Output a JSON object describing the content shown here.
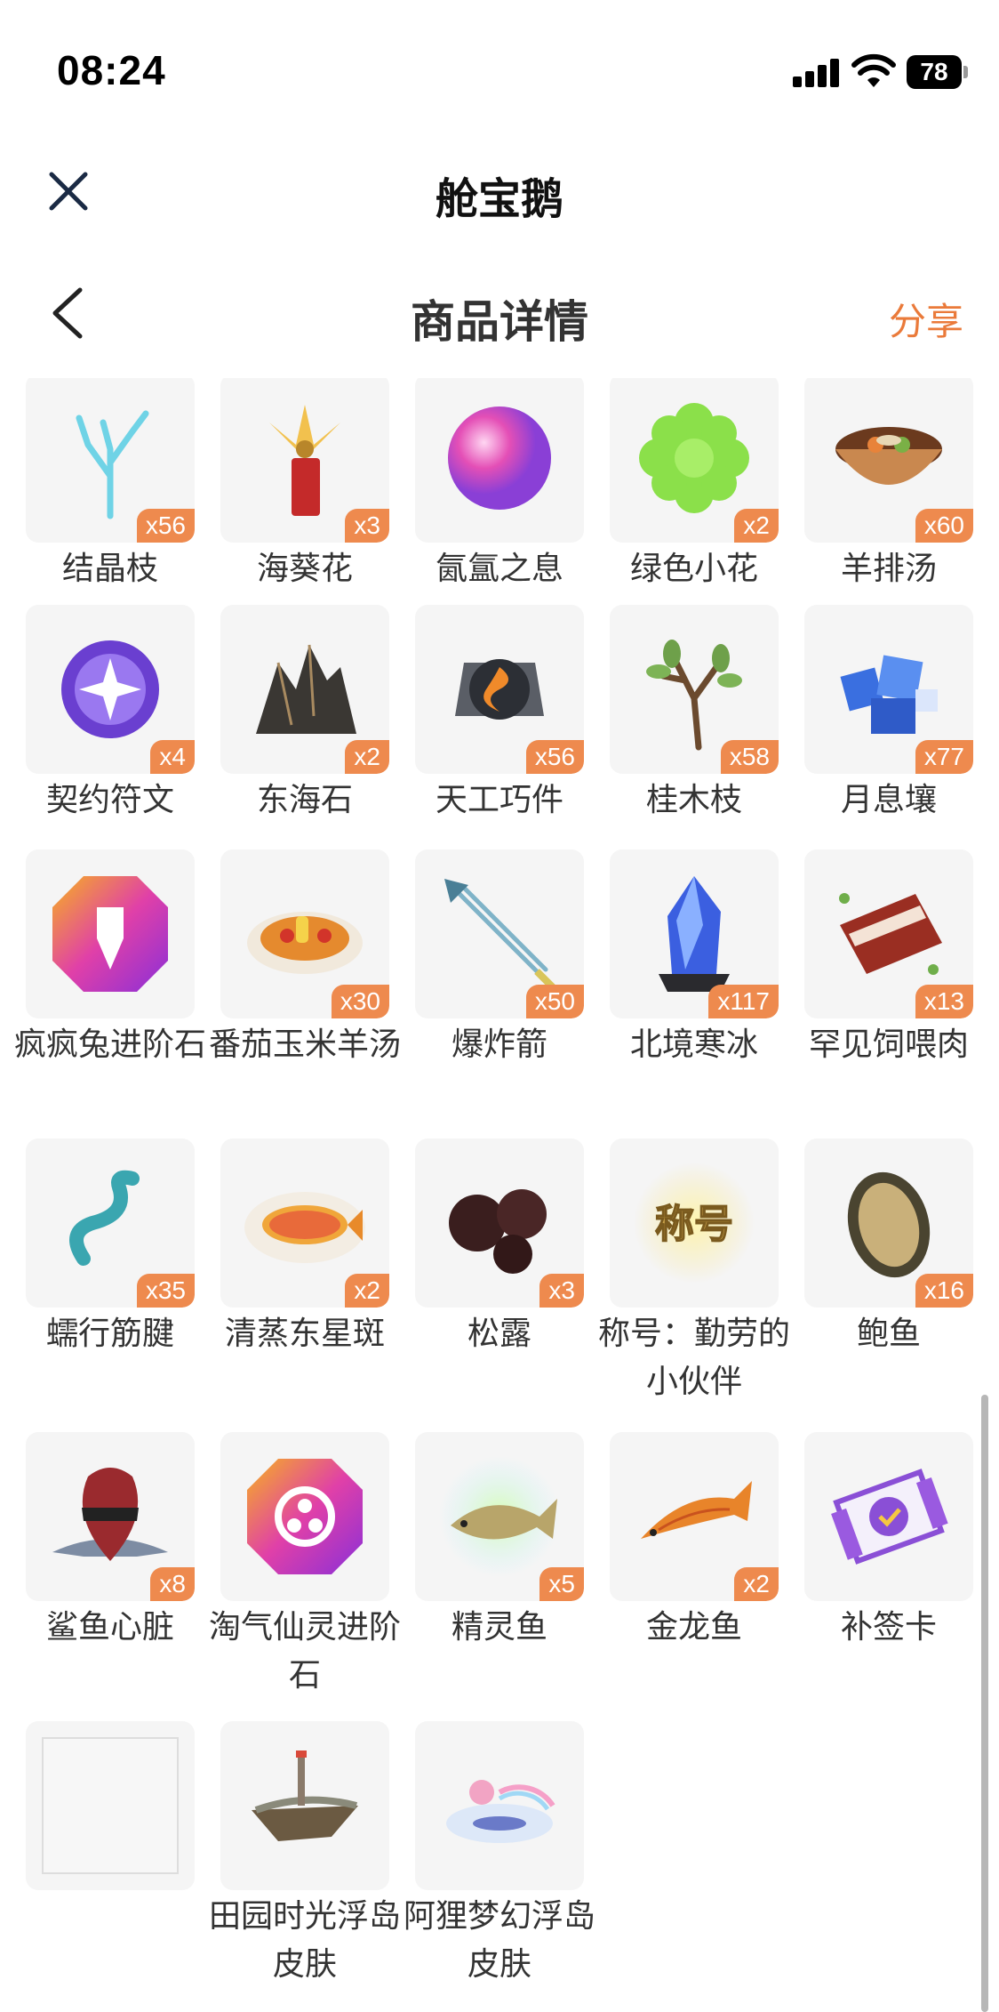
{
  "status_bar": {
    "time": "08:24",
    "battery": "78"
  },
  "mini_program": {
    "title": "舱宝鹅"
  },
  "header": {
    "title": "商品详情",
    "share": "分享"
  },
  "colors": {
    "accent": "#ea7a3a",
    "badge": "#ee8a4e",
    "tile_bg": "#f5f5f5"
  },
  "items": [
    {
      "name": "结晶枝",
      "count": "x56",
      "icon": "crystal-branch-icon"
    },
    {
      "name": "海葵花",
      "count": "x3",
      "icon": "anemone-flower-icon"
    },
    {
      "name": "氤氲之息",
      "count": "",
      "icon": "mist-orb-icon"
    },
    {
      "name": "绿色小花",
      "count": "x2",
      "icon": "green-flower-icon"
    },
    {
      "name": "羊排汤",
      "count": "x60",
      "icon": "lamb-soup-icon"
    },
    {
      "name": "契约符文",
      "count": "x4",
      "icon": "contract-rune-icon"
    },
    {
      "name": "东海石",
      "count": "x2",
      "icon": "east-sea-stone-icon"
    },
    {
      "name": "天工巧件",
      "count": "x56",
      "icon": "crafted-part-icon"
    },
    {
      "name": "桂木枝",
      "count": "x58",
      "icon": "laurel-branch-icon"
    },
    {
      "name": "月息壤",
      "count": "x77",
      "icon": "moon-soil-icon"
    },
    {
      "name": "疯疯兔进阶石",
      "count": "",
      "icon": "rabbit-gem-icon"
    },
    {
      "name": "番茄玉米羊汤",
      "count": "x30",
      "icon": "tomato-corn-soup-icon"
    },
    {
      "name": "爆炸箭",
      "count": "x50",
      "icon": "explosive-arrow-icon"
    },
    {
      "name": "北境寒冰",
      "count": "x117",
      "icon": "northern-ice-icon"
    },
    {
      "name": "罕见饲喂肉",
      "count": "x13",
      "icon": "rare-meat-icon"
    },
    {
      "name": "蠕行筋腱",
      "count": "x35",
      "icon": "tendon-icon"
    },
    {
      "name": "清蒸东星斑",
      "count": "x2",
      "icon": "steamed-fish-icon"
    },
    {
      "name": "松露",
      "count": "x3",
      "icon": "truffle-icon"
    },
    {
      "name": "称号：勤劳的小伙伴",
      "count": "",
      "icon": "title-badge-icon",
      "icon_text": "称号"
    },
    {
      "name": "鲍鱼",
      "count": "x16",
      "icon": "abalone-icon"
    },
    {
      "name": "鲨鱼心脏",
      "count": "x8",
      "icon": "shark-heart-icon"
    },
    {
      "name": "淘气仙灵进阶石",
      "count": "",
      "icon": "fairy-gem-icon"
    },
    {
      "name": "精灵鱼",
      "count": "x5",
      "icon": "spirit-fish-icon"
    },
    {
      "name": "金龙鱼",
      "count": "x2",
      "icon": "arowana-icon"
    },
    {
      "name": "补签卡",
      "count": "",
      "icon": "makeup-card-icon"
    },
    {
      "name": "",
      "count": "",
      "icon": "empty-placeholder-icon"
    },
    {
      "name": "田园时光浮岛皮肤",
      "count": "",
      "icon": "pastoral-island-icon"
    },
    {
      "name": "阿狸梦幻浮岛皮肤",
      "count": "",
      "icon": "dream-island-icon"
    }
  ]
}
